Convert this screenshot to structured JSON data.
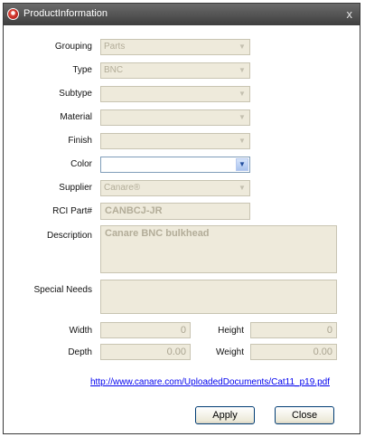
{
  "window": {
    "title": "ProductInformation",
    "close_glyph": "x",
    "icon_name": "app-logo-icon"
  },
  "form": {
    "grouping": {
      "label": "Grouping",
      "value": "Parts"
    },
    "type": {
      "label": "Type",
      "value": "BNC"
    },
    "subtype": {
      "label": "Subtype",
      "value": ""
    },
    "material": {
      "label": "Material",
      "value": ""
    },
    "finish": {
      "label": "Finish",
      "value": ""
    },
    "color": {
      "label": "Color",
      "value": ""
    },
    "supplier": {
      "label": "Supplier",
      "value": "Canare®"
    },
    "part_number": {
      "label": "RCI Part#",
      "value": "CANBCJ-JR"
    },
    "description": {
      "label": "Description",
      "value": "Canare BNC bulkhead"
    },
    "special_needs": {
      "label": "Special Needs",
      "value": ""
    },
    "width": {
      "label": "Width",
      "value": "0"
    },
    "height": {
      "label": "Height",
      "value": "0"
    },
    "depth": {
      "label": "Depth",
      "value": "0.00"
    },
    "weight": {
      "label": "Weight",
      "value": "0.00"
    }
  },
  "link": {
    "text": "http://www.canare.com/UploadedDocuments/Cat11_p19.pdf"
  },
  "buttons": {
    "apply": "Apply",
    "close": "Close"
  },
  "colors": {
    "titlebar": "#4e4e4e",
    "disabled_field": "#eeeadb",
    "link": "#0000ee",
    "button_border": "#003c74"
  }
}
